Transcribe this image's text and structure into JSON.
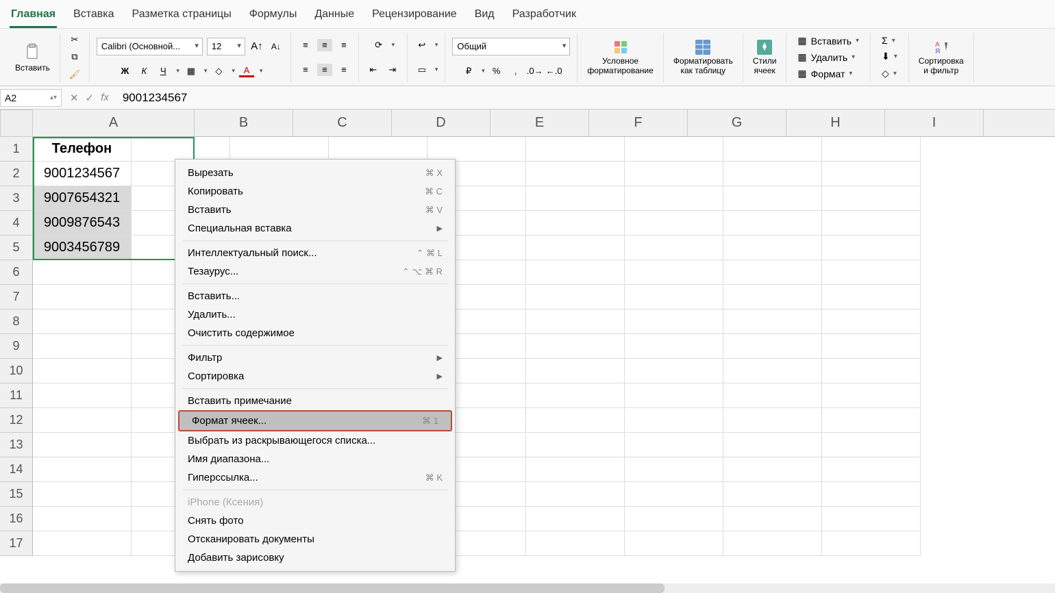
{
  "tabs": [
    "Главная",
    "Вставка",
    "Разметка страницы",
    "Формулы",
    "Данные",
    "Рецензирование",
    "Вид",
    "Разработчик"
  ],
  "activeTab": 0,
  "ribbon": {
    "paste": "Вставить",
    "fontName": "Calibri (Основной...",
    "fontSize": "12",
    "numberFormat": "Общий",
    "conditional": "Условное\nформатирование",
    "asTable": "Форматировать\nкак таблицу",
    "cellStyles": "Стили\nячеек",
    "insert": "Вставить",
    "delete": "Удалить",
    "format": "Формат",
    "sortFilter": "Сортировка\nи фильтр"
  },
  "nameBox": "A2",
  "formula": "9001234567",
  "columns": [
    "A",
    "B",
    "C",
    "D",
    "E",
    "F",
    "G",
    "H",
    "I"
  ],
  "rowCount": 17,
  "data": {
    "header": "Телефон",
    "values": [
      "9001234567",
      "9007654321",
      "9009876543",
      "9003456789"
    ]
  },
  "ctx": {
    "cut": "Вырезать",
    "cutK": "⌘ X",
    "copy": "Копировать",
    "copyK": "⌘ C",
    "paste": "Вставить",
    "pasteK": "⌘ V",
    "pspecial": "Специальная вставка",
    "smart": "Интеллектуальный поиск...",
    "smartK": "⌃ ⌘ L",
    "thesaurus": "Тезаурус...",
    "thesK": "⌃ ⌥ ⌘ R",
    "ins": "Вставить...",
    "del": "Удалить...",
    "clear": "Очистить содержимое",
    "filter": "Фильтр",
    "sort": "Сортировка",
    "comment": "Вставить примечание",
    "fmt": "Формат ячеек...",
    "fmtK": "⌘ 1",
    "dropdown": "Выбрать из раскрывающегося списка...",
    "rangeName": "Имя диапазона...",
    "link": "Гиперссылка...",
    "linkK": "⌘ K",
    "iphone": "iPhone (Ксения)",
    "photo": "Снять фото",
    "scan": "Отсканировать документы",
    "sketch": "Добавить зарисовку"
  }
}
